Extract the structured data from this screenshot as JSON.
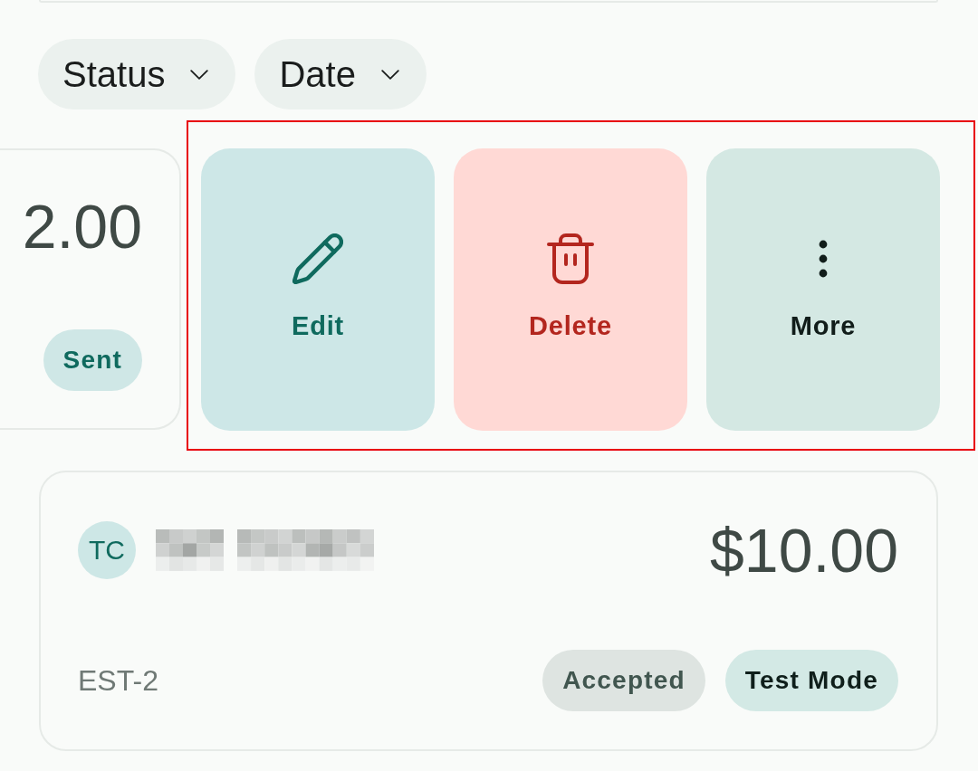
{
  "filters": [
    {
      "label": "Status"
    },
    {
      "label": "Date"
    }
  ],
  "swiped_card": {
    "amount": "2.00",
    "badges": [
      {
        "kind": "sent",
        "label": "Sent"
      }
    ]
  },
  "swipe_actions": {
    "highlighted": true,
    "items": [
      {
        "kind": "edit",
        "label": "Edit"
      },
      {
        "kind": "delete",
        "label": "Delete"
      },
      {
        "kind": "more",
        "label": "More"
      }
    ]
  },
  "cards": [
    {
      "initials": "TC",
      "name_redacted": true,
      "amount": "$10.00",
      "number": "EST-2",
      "badges": [
        {
          "kind": "accepted",
          "label": "Accepted"
        },
        {
          "kind": "mode",
          "label": "Test Mode"
        }
      ]
    }
  ]
}
